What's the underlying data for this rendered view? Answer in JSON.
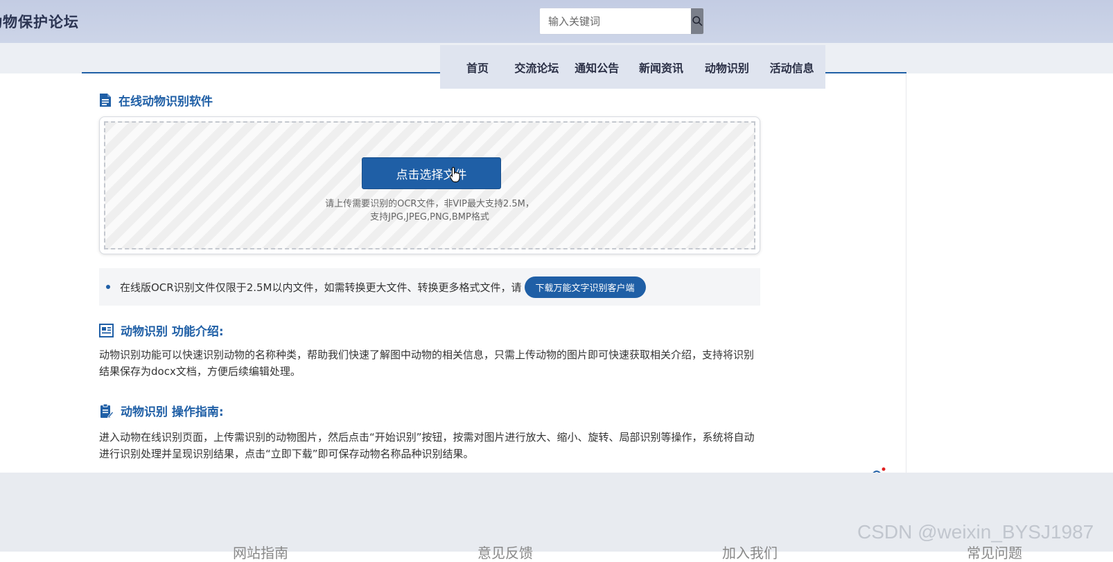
{
  "header": {
    "site_title": "动物保护论坛",
    "search": {
      "placeholder": "输入关键词",
      "value": ""
    }
  },
  "nav": {
    "items": [
      {
        "label": "首页"
      },
      {
        "label": "交流论坛"
      },
      {
        "label": "通知公告"
      },
      {
        "label": "新闻资讯"
      },
      {
        "label": "动物识别"
      },
      {
        "label": "活动信息"
      }
    ]
  },
  "upload": {
    "section_title": "在线动物识别软件",
    "choose_button": "点击选择文件",
    "hint_line1": "请上传需要识别的OCR文件，非VIP最大支持2.5M，",
    "hint_line2": "支持JPG,JPEG,PNG,BMP格式"
  },
  "notice": {
    "text": "在线版OCR识别文件仅限于2.5M以内文件，如需转换更大文件、转换更多格式文件，请",
    "button": "下载万能文字识别客户端"
  },
  "intro": {
    "title": "动物识别 功能介绍:",
    "body": "动物识别功能可以快速识别动物的名称种类，帮助我们快速了解图中动物的相关信息，只需上传动物的图片即可快速获取相关介绍，支持将识别结果保存为docx文档，方便后续编辑处理。"
  },
  "guide": {
    "title": "动物识别 操作指南:",
    "body": "进入动物在线识别页面，上传需识别的动物图片，然后点击“开始识别”按钮，按需对图片进行放大、缩小、旋转、局部识别等操作，系统将自动进行识别处理并呈现识别结果，点击“立即下载”即可保存动物名称品种识别结果。"
  },
  "footer": {
    "links": [
      "网站指南",
      "意见反馈",
      "加入我们",
      "常见问题"
    ]
  },
  "watermark": "CSDN @weixin_BYSJ1987",
  "colors": {
    "accent": "#1f5fa6",
    "topbar": "#c8d0e6",
    "nav_bg": "#dfe4ef"
  }
}
